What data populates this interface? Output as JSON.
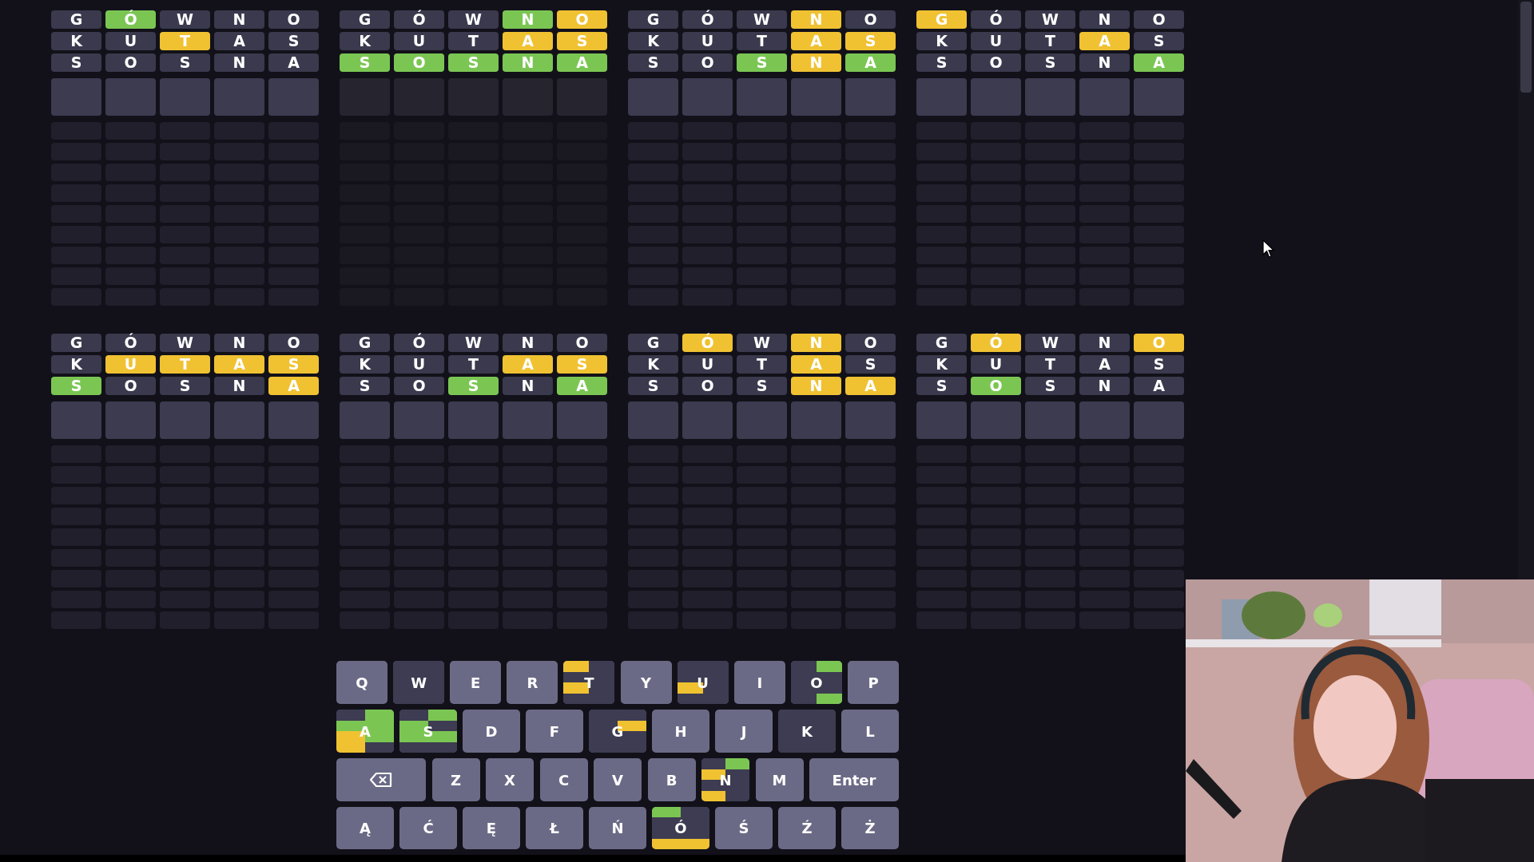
{
  "boards": [
    {
      "solved": false,
      "guesses": [
        {
          "tiles": [
            {
              "letter": "G",
              "kind": "absent"
            },
            {
              "letter": "Ó",
              "kind": "correct"
            },
            {
              "letter": "W",
              "kind": "absent"
            },
            {
              "letter": "N",
              "kind": "absent"
            },
            {
              "letter": "O",
              "kind": "absent"
            }
          ]
        },
        {
          "tiles": [
            {
              "letter": "K",
              "kind": "absent"
            },
            {
              "letter": "U",
              "kind": "absent"
            },
            {
              "letter": "T",
              "kind": "present"
            },
            {
              "letter": "A",
              "kind": "absent"
            },
            {
              "letter": "S",
              "kind": "absent"
            }
          ]
        },
        {
          "tiles": [
            {
              "letter": "S",
              "kind": "absent"
            },
            {
              "letter": "O",
              "kind": "absent"
            },
            {
              "letter": "S",
              "kind": "absent"
            },
            {
              "letter": "N",
              "kind": "absent"
            },
            {
              "letter": "A",
              "kind": "absent"
            }
          ]
        }
      ]
    },
    {
      "solved": true,
      "guesses": [
        {
          "tiles": [
            {
              "letter": "G",
              "kind": "absent"
            },
            {
              "letter": "Ó",
              "kind": "absent"
            },
            {
              "letter": "W",
              "kind": "absent"
            },
            {
              "letter": "N",
              "kind": "correct"
            },
            {
              "letter": "O",
              "kind": "present"
            }
          ]
        },
        {
          "tiles": [
            {
              "letter": "K",
              "kind": "absent"
            },
            {
              "letter": "U",
              "kind": "absent"
            },
            {
              "letter": "T",
              "kind": "absent"
            },
            {
              "letter": "A",
              "kind": "present"
            },
            {
              "letter": "S",
              "kind": "present"
            }
          ]
        },
        {
          "tiles": [
            {
              "letter": "S",
              "kind": "correct"
            },
            {
              "letter": "O",
              "kind": "correct"
            },
            {
              "letter": "S",
              "kind": "correct"
            },
            {
              "letter": "N",
              "kind": "correct"
            },
            {
              "letter": "A",
              "kind": "correct"
            }
          ]
        }
      ]
    },
    {
      "solved": false,
      "guesses": [
        {
          "tiles": [
            {
              "letter": "G",
              "kind": "absent"
            },
            {
              "letter": "Ó",
              "kind": "absent"
            },
            {
              "letter": "W",
              "kind": "absent"
            },
            {
              "letter": "N",
              "kind": "present"
            },
            {
              "letter": "O",
              "kind": "absent"
            }
          ]
        },
        {
          "tiles": [
            {
              "letter": "K",
              "kind": "absent"
            },
            {
              "letter": "U",
              "kind": "absent"
            },
            {
              "letter": "T",
              "kind": "absent"
            },
            {
              "letter": "A",
              "kind": "present"
            },
            {
              "letter": "S",
              "kind": "present"
            }
          ]
        },
        {
          "tiles": [
            {
              "letter": "S",
              "kind": "absent"
            },
            {
              "letter": "O",
              "kind": "absent"
            },
            {
              "letter": "S",
              "kind": "correct"
            },
            {
              "letter": "N",
              "kind": "present"
            },
            {
              "letter": "A",
              "kind": "correct"
            }
          ]
        }
      ]
    },
    {
      "solved": false,
      "guesses": [
        {
          "tiles": [
            {
              "letter": "G",
              "kind": "present"
            },
            {
              "letter": "Ó",
              "kind": "absent"
            },
            {
              "letter": "W",
              "kind": "absent"
            },
            {
              "letter": "N",
              "kind": "absent"
            },
            {
              "letter": "O",
              "kind": "absent"
            }
          ]
        },
        {
          "tiles": [
            {
              "letter": "K",
              "kind": "absent"
            },
            {
              "letter": "U",
              "kind": "absent"
            },
            {
              "letter": "T",
              "kind": "absent"
            },
            {
              "letter": "A",
              "kind": "present"
            },
            {
              "letter": "S",
              "kind": "absent"
            }
          ]
        },
        {
          "tiles": [
            {
              "letter": "S",
              "kind": "absent"
            },
            {
              "letter": "O",
              "kind": "absent"
            },
            {
              "letter": "S",
              "kind": "absent"
            },
            {
              "letter": "N",
              "kind": "absent"
            },
            {
              "letter": "A",
              "kind": "correct"
            }
          ]
        }
      ]
    },
    {
      "solved": false,
      "guesses": [
        {
          "tiles": [
            {
              "letter": "G",
              "kind": "absent"
            },
            {
              "letter": "Ó",
              "kind": "absent"
            },
            {
              "letter": "W",
              "kind": "absent"
            },
            {
              "letter": "N",
              "kind": "absent"
            },
            {
              "letter": "O",
              "kind": "absent"
            }
          ]
        },
        {
          "tiles": [
            {
              "letter": "K",
              "kind": "absent"
            },
            {
              "letter": "U",
              "kind": "present"
            },
            {
              "letter": "T",
              "kind": "present"
            },
            {
              "letter": "A",
              "kind": "present"
            },
            {
              "letter": "S",
              "kind": "present"
            }
          ]
        },
        {
          "tiles": [
            {
              "letter": "S",
              "kind": "correct"
            },
            {
              "letter": "O",
              "kind": "absent"
            },
            {
              "letter": "S",
              "kind": "absent"
            },
            {
              "letter": "N",
              "kind": "absent"
            },
            {
              "letter": "A",
              "kind": "present"
            }
          ]
        }
      ]
    },
    {
      "solved": false,
      "guesses": [
        {
          "tiles": [
            {
              "letter": "G",
              "kind": "absent"
            },
            {
              "letter": "Ó",
              "kind": "absent"
            },
            {
              "letter": "W",
              "kind": "absent"
            },
            {
              "letter": "N",
              "kind": "absent"
            },
            {
              "letter": "O",
              "kind": "absent"
            }
          ]
        },
        {
          "tiles": [
            {
              "letter": "K",
              "kind": "absent"
            },
            {
              "letter": "U",
              "kind": "absent"
            },
            {
              "letter": "T",
              "kind": "absent"
            },
            {
              "letter": "A",
              "kind": "present"
            },
            {
              "letter": "S",
              "kind": "present"
            }
          ]
        },
        {
          "tiles": [
            {
              "letter": "S",
              "kind": "absent"
            },
            {
              "letter": "O",
              "kind": "absent"
            },
            {
              "letter": "S",
              "kind": "correct"
            },
            {
              "letter": "N",
              "kind": "absent"
            },
            {
              "letter": "A",
              "kind": "correct"
            }
          ]
        }
      ]
    },
    {
      "solved": false,
      "guesses": [
        {
          "tiles": [
            {
              "letter": "G",
              "kind": "absent"
            },
            {
              "letter": "Ó",
              "kind": "present"
            },
            {
              "letter": "W",
              "kind": "absent"
            },
            {
              "letter": "N",
              "kind": "present"
            },
            {
              "letter": "O",
              "kind": "absent"
            }
          ]
        },
        {
          "tiles": [
            {
              "letter": "K",
              "kind": "absent"
            },
            {
              "letter": "U",
              "kind": "absent"
            },
            {
              "letter": "T",
              "kind": "absent"
            },
            {
              "letter": "A",
              "kind": "present"
            },
            {
              "letter": "S",
              "kind": "absent"
            }
          ]
        },
        {
          "tiles": [
            {
              "letter": "S",
              "kind": "absent"
            },
            {
              "letter": "O",
              "kind": "absent"
            },
            {
              "letter": "S",
              "kind": "absent"
            },
            {
              "letter": "N",
              "kind": "present"
            },
            {
              "letter": "A",
              "kind": "present"
            }
          ]
        }
      ]
    },
    {
      "solved": false,
      "guesses": [
        {
          "tiles": [
            {
              "letter": "G",
              "kind": "absent"
            },
            {
              "letter": "Ó",
              "kind": "present"
            },
            {
              "letter": "W",
              "kind": "absent"
            },
            {
              "letter": "N",
              "kind": "absent"
            },
            {
              "letter": "O",
              "kind": "present"
            }
          ]
        },
        {
          "tiles": [
            {
              "letter": "K",
              "kind": "absent"
            },
            {
              "letter": "U",
              "kind": "absent"
            },
            {
              "letter": "T",
              "kind": "absent"
            },
            {
              "letter": "A",
              "kind": "absent"
            },
            {
              "letter": "S",
              "kind": "absent"
            }
          ]
        },
        {
          "tiles": [
            {
              "letter": "S",
              "kind": "absent"
            },
            {
              "letter": "O",
              "kind": "correct"
            },
            {
              "letter": "S",
              "kind": "absent"
            },
            {
              "letter": "N",
              "kind": "absent"
            },
            {
              "letter": "A",
              "kind": "absent"
            }
          ]
        }
      ]
    }
  ],
  "keyboard": {
    "rows": [
      [
        {
          "kind": "letter",
          "label": "Q"
        },
        {
          "kind": "letter",
          "label": "W"
        },
        {
          "kind": "letter",
          "label": "E"
        },
        {
          "kind": "letter",
          "label": "R"
        },
        {
          "kind": "letter",
          "label": "T"
        },
        {
          "kind": "letter",
          "label": "Y"
        },
        {
          "kind": "letter",
          "label": "U"
        },
        {
          "kind": "letter",
          "label": "I"
        },
        {
          "kind": "letter",
          "label": "O"
        },
        {
          "kind": "letter",
          "label": "P"
        }
      ],
      [
        {
          "kind": "letter",
          "label": "A"
        },
        {
          "kind": "letter",
          "label": "S"
        },
        {
          "kind": "letter",
          "label": "D"
        },
        {
          "kind": "letter",
          "label": "F"
        },
        {
          "kind": "letter",
          "label": "G"
        },
        {
          "kind": "letter",
          "label": "H"
        },
        {
          "kind": "letter",
          "label": "J"
        },
        {
          "kind": "letter",
          "label": "K"
        },
        {
          "kind": "letter",
          "label": "L"
        }
      ],
      [
        {
          "kind": "backspace"
        },
        {
          "kind": "letter",
          "label": "Z"
        },
        {
          "kind": "letter",
          "label": "X"
        },
        {
          "kind": "letter",
          "label": "C"
        },
        {
          "kind": "letter",
          "label": "V"
        },
        {
          "kind": "letter",
          "label": "B"
        },
        {
          "kind": "letter",
          "label": "N"
        },
        {
          "kind": "letter",
          "label": "M"
        },
        {
          "kind": "enter",
          "label": "Enter"
        }
      ],
      [
        {
          "kind": "letter",
          "label": "Ą"
        },
        {
          "kind": "letter",
          "label": "Ć"
        },
        {
          "kind": "letter",
          "label": "Ę"
        },
        {
          "kind": "letter",
          "label": "Ł"
        },
        {
          "kind": "letter",
          "label": "Ń"
        },
        {
          "kind": "letter",
          "label": "Ó"
        },
        {
          "kind": "letter",
          "label": "Ś"
        },
        {
          "kind": "letter",
          "label": "Ź"
        },
        {
          "kind": "letter",
          "label": "Ż"
        }
      ]
    ]
  }
}
